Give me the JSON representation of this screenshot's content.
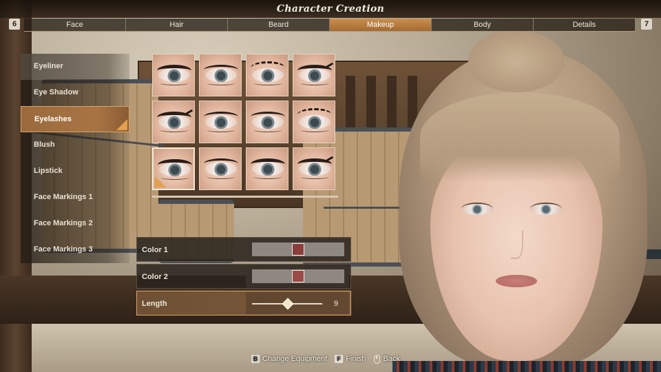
{
  "window": {
    "title": "Character Creation"
  },
  "tabs": {
    "left_key": "6",
    "right_key": "7",
    "items": [
      {
        "label": "Face"
      },
      {
        "label": "Hair"
      },
      {
        "label": "Beard"
      },
      {
        "label": "Makeup",
        "active": true
      },
      {
        "label": "Body"
      },
      {
        "label": "Details"
      }
    ]
  },
  "makeup_menu": {
    "items": [
      {
        "label": "Eyeliner"
      },
      {
        "label": "Eye Shadow"
      },
      {
        "label": "Eyelashes",
        "selected": true
      },
      {
        "label": "Blush"
      },
      {
        "label": "Lipstick"
      },
      {
        "label": "Face Markings 1"
      },
      {
        "label": "Face Markings 2"
      },
      {
        "label": "Face Markings 3"
      }
    ]
  },
  "eyelash_presets": {
    "count": 12,
    "selected_index": 8
  },
  "settings": {
    "color1": {
      "label": "Color 1",
      "color": "#8a3e3a",
      "position": 0.5
    },
    "color2": {
      "label": "Color 2",
      "color": "#9a4a48",
      "position": 0.5
    },
    "length": {
      "label": "Length",
      "value": "9",
      "fraction": 0.5
    }
  },
  "footer": {
    "change_equipment": {
      "key": "B",
      "label": "Change Equipment"
    },
    "finish": {
      "key": "F",
      "label": "Finish"
    },
    "back": {
      "icon": "mouse-icon",
      "label": "Back"
    }
  },
  "colors": {
    "accent": "#c98f4f",
    "highlight": "#e3a04e"
  }
}
